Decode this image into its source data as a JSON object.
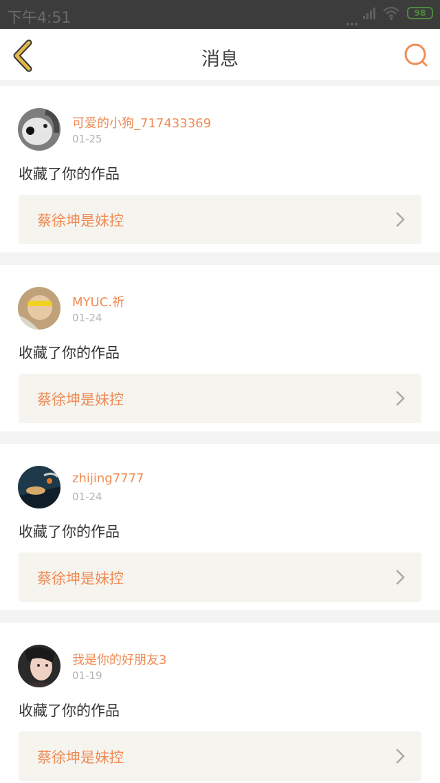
{
  "status_bar": {
    "time": "下午4:51",
    "battery": "98"
  },
  "nav": {
    "title": "消息",
    "back_icon": "chevron-left-icon",
    "search_icon": "search-icon"
  },
  "colors": {
    "accent": "#f08b55",
    "back_icon": "#e1b84a",
    "status_bar": "#3c3c3c"
  },
  "messages": [
    {
      "username": "可爱的小狗_717433369",
      "date": "01-25",
      "action": "收藏了你的作品",
      "work_title": "蔡徐坤是妹控"
    },
    {
      "username": "MYUC.祈",
      "date": "01-24",
      "action": "收藏了你的作品",
      "work_title": "蔡徐坤是妹控"
    },
    {
      "username": "zhijing7777",
      "date": "01-24",
      "action": "收藏了你的作品",
      "work_title": "蔡徐坤是妹控"
    },
    {
      "username": "我是你的好朋友3",
      "date": "01-19",
      "action": "收藏了你的作品",
      "work_title": "蔡徐坤是妹控"
    }
  ]
}
